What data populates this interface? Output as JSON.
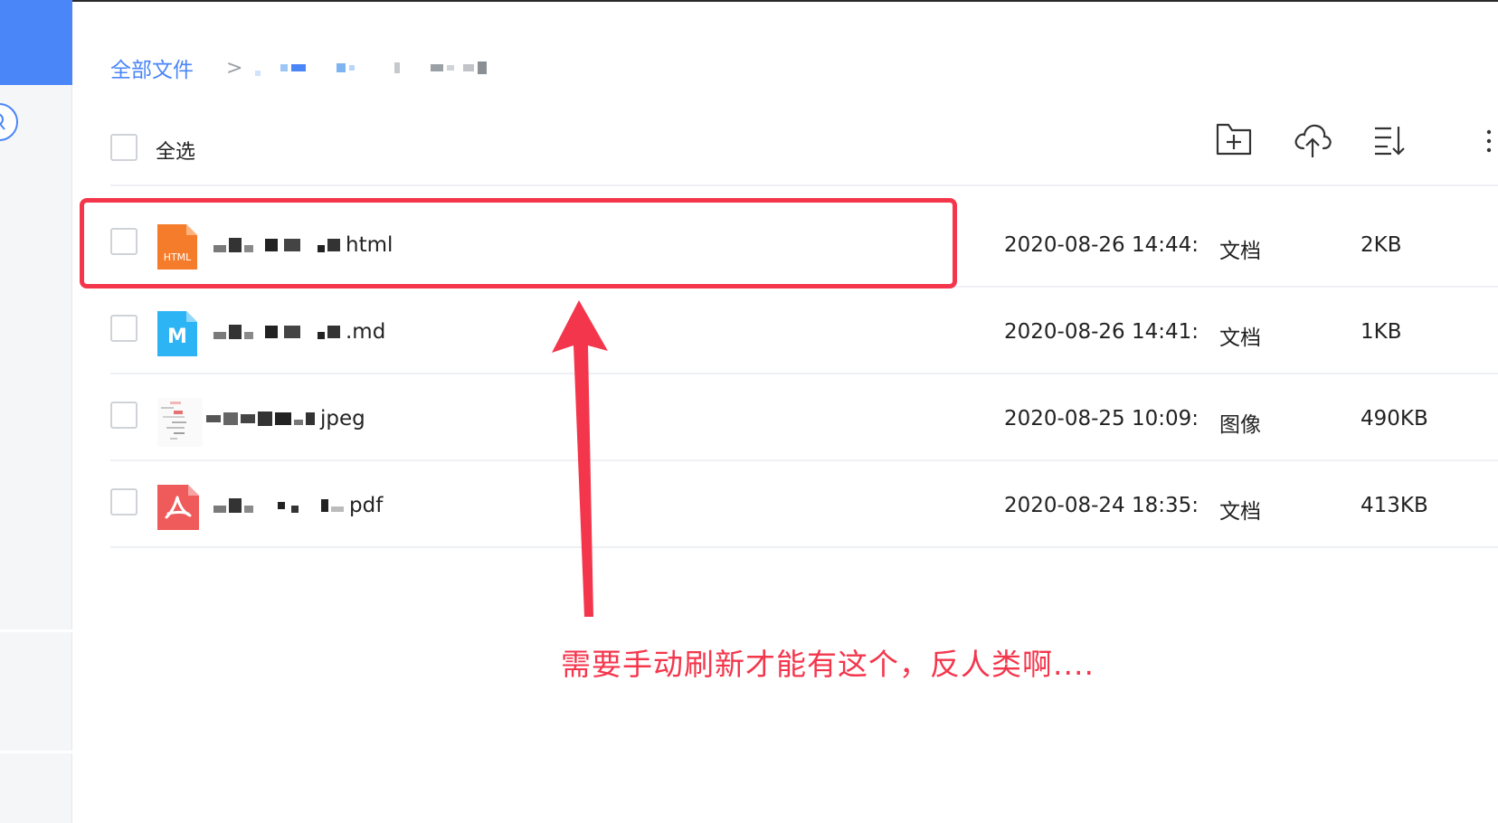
{
  "breadcrumb": {
    "root": "全部文件",
    "separator": ">"
  },
  "list_header": {
    "select_all_label": "全选",
    "tools": [
      "new-folder-icon",
      "upload-cloud-icon",
      "sort-icon",
      "more-icon"
    ]
  },
  "files": [
    {
      "name_suffix": "html",
      "date": "2020-08-26 14:44:",
      "type": "文档",
      "size": "2KB",
      "icon": "html-file-icon",
      "icon_label": "HTML",
      "icon_color": "#f57c2b"
    },
    {
      "name_suffix": ".md",
      "date": "2020-08-26 14:41:",
      "type": "文档",
      "size": "1KB",
      "icon": "markdown-file-icon",
      "icon_label": "M",
      "icon_color": "#2db4f5"
    },
    {
      "name_suffix": "jpeg",
      "date": "2020-08-25 10:09:",
      "type": "图像",
      "size": "490KB",
      "icon": "image-thumbnail-icon",
      "icon_label": "",
      "icon_color": "#f2f2f2"
    },
    {
      "name_suffix": "pdf",
      "date": "2020-08-24 18:35:",
      "type": "文档",
      "size": "413KB",
      "icon": "pdf-file-icon",
      "icon_label": "",
      "icon_color": "#ef5a5a"
    }
  ],
  "annotation": {
    "text": "需要手动刷新才能有这个，反人类啊....",
    "color": "#f4364c"
  },
  "colors": {
    "accent": "#4a86f7",
    "annotation": "#f4364c"
  }
}
